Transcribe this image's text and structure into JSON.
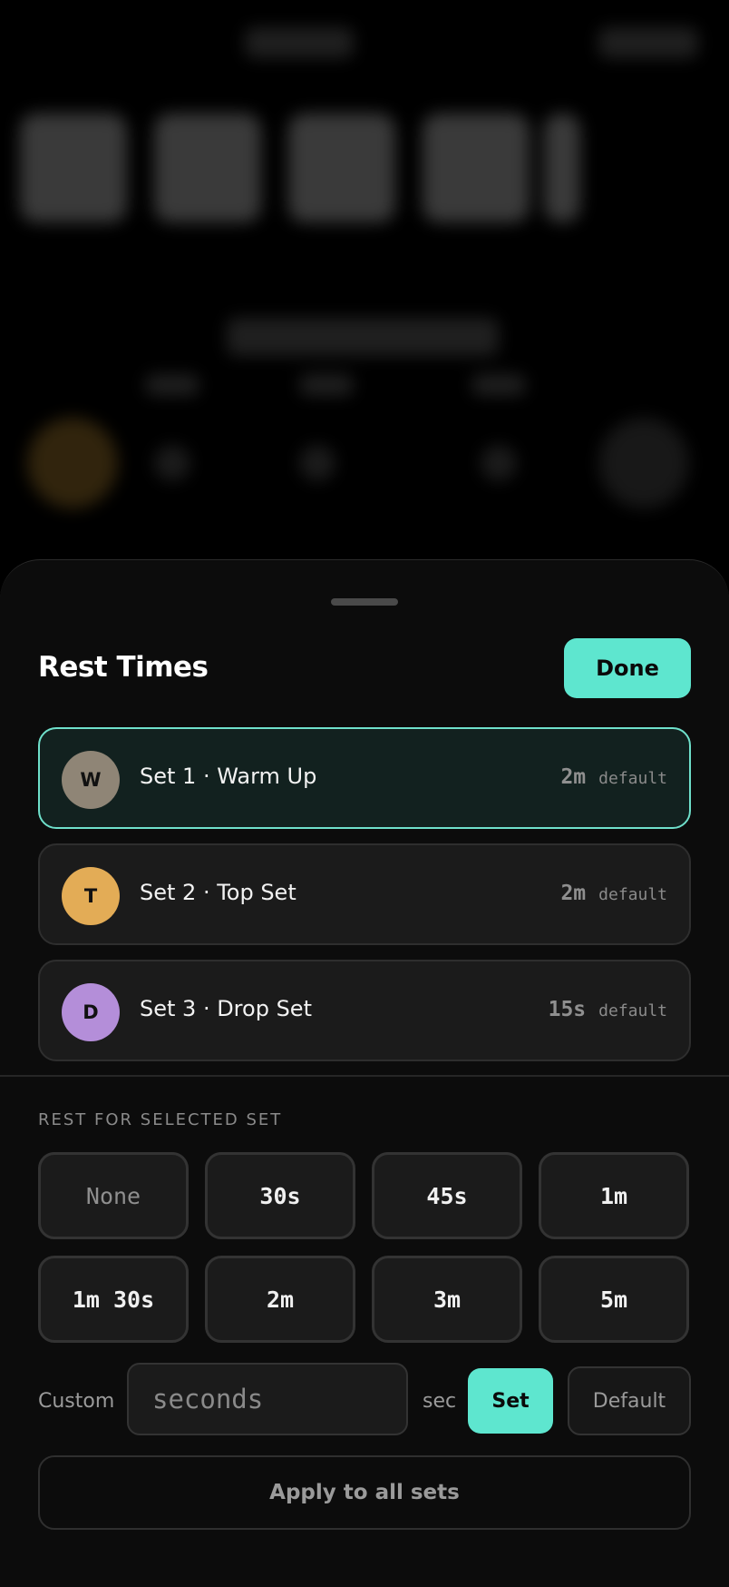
{
  "sheet": {
    "title": "Rest Times",
    "done_label": "Done"
  },
  "sets": [
    {
      "initial": "W",
      "name": "Set 1 · Warm Up",
      "rest": "2m",
      "rest_note": "default",
      "avatar_color": "#8f8576",
      "selected": true
    },
    {
      "initial": "T",
      "name": "Set 2 · Top Set",
      "rest": "2m",
      "rest_note": "default",
      "avatar_color": "#e3ac56",
      "selected": false
    },
    {
      "initial": "D",
      "name": "Set 3 · Drop Set",
      "rest": "15s",
      "rest_note": "default",
      "avatar_color": "#b48ed9",
      "selected": false
    }
  ],
  "rest_section": {
    "label": "REST FOR SELECTED SET",
    "presets": [
      "None",
      "30s",
      "45s",
      "1m",
      "1m 30s",
      "2m",
      "3m",
      "5m"
    ]
  },
  "custom": {
    "label": "Custom",
    "placeholder": "seconds",
    "unit": "sec",
    "set_label": "Set",
    "default_label": "Default"
  },
  "apply_all_label": "Apply to all sets",
  "colors": {
    "accent": "#5ee6cf",
    "selected_border": "#6fe0cb",
    "sheet_bg": "#0c0c0c",
    "card_bg": "#1b1b1b"
  }
}
